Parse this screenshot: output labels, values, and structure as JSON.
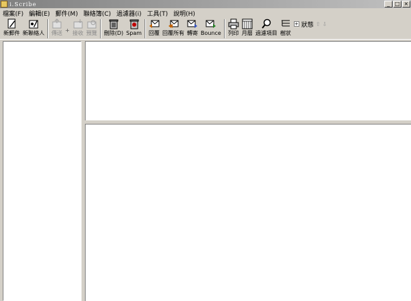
{
  "window": {
    "title": "i.Scribe"
  },
  "menu": [
    "檔案(F)",
    "編輯(E)",
    "郵件(M)",
    "聯絡簿(C)",
    "過濾器(i)",
    "工具(T)",
    "說明(H)"
  ],
  "toolbar": {
    "new_mail": "新郵件",
    "new_contact": "新聯絡人",
    "send": "傳送",
    "plus": "+",
    "receive": "接收",
    "preview": "預覽",
    "delete": "刪除(D)",
    "spam": "Spam",
    "reply": "回覆",
    "reply_all": "回覆所有",
    "forward": "轉寄",
    "bounce": "Bounce",
    "print": "列印",
    "calendar": "月曆",
    "filter_items": "過濾項目",
    "threads": "樹狀",
    "status_label": "狀態"
  },
  "colors": {
    "window_bg": "#d4d0c8",
    "pane_bg": "#ffffff",
    "title_grad_start": "#808080"
  }
}
